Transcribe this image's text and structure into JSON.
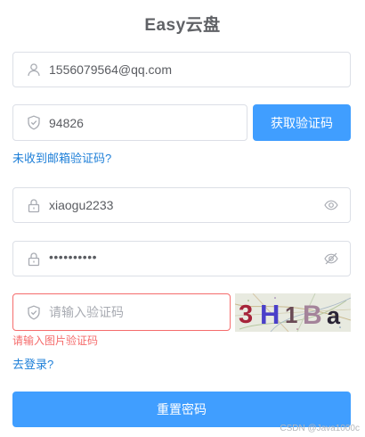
{
  "app": {
    "title": "Easy云盘"
  },
  "form": {
    "email": {
      "value": "1556079564@qq.com"
    },
    "email_code": {
      "value": "94826"
    },
    "send_code_button": "获取验证码",
    "not_received_link": "未收到邮箱验证码?",
    "username": {
      "value": "xiaogu2233"
    },
    "password": {
      "value": "••••••••••"
    },
    "captcha_input": {
      "placeholder": "请输入验证码",
      "error": "请输入图片验证码"
    },
    "captcha_image": {
      "text": "3H1Ba"
    },
    "login_link": "去登录?",
    "submit_button": "重置密码"
  },
  "watermark": "CSDN @Java1000c",
  "colors": {
    "primary": "#409eff",
    "error": "#f56c6c",
    "link": "#1e7fd8",
    "border": "#dcdfe6"
  },
  "icons": {
    "email": "user-icon",
    "code": "shield-check-icon",
    "username": "lock-icon",
    "password": "lock-icon",
    "show_password": "eye-icon",
    "hide_password": "eye-off-icon",
    "captcha": "shield-check-icon"
  }
}
